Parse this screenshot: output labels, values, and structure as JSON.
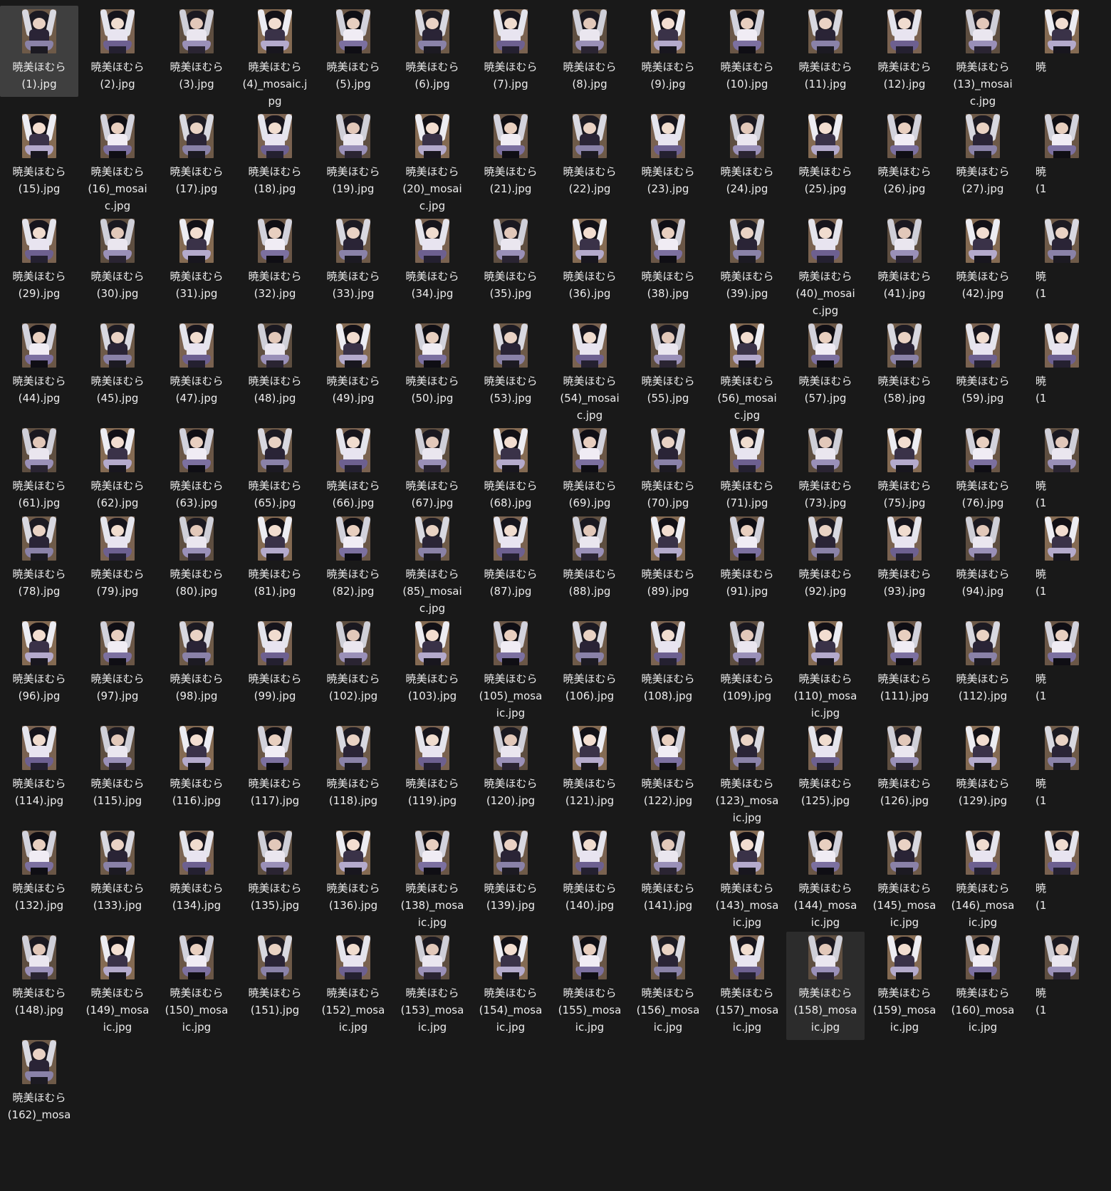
{
  "explorer": {
    "rows": [
      {
        "items": [
          {
            "name": "暁美ほむら\n(1).jpg"
          },
          {
            "name": "暁美ほむら\n(2).jpg"
          },
          {
            "name": "暁美ほむら\n(3).jpg"
          },
          {
            "name": "暁美ほむら\n(4)_mosaic.j\npg"
          },
          {
            "name": "暁美ほむら\n(5).jpg"
          },
          {
            "name": "暁美ほむら\n(6).jpg"
          },
          {
            "name": "暁美ほむら\n(7).jpg"
          },
          {
            "name": "暁美ほむら\n(8).jpg"
          },
          {
            "name": "暁美ほむら\n(9).jpg"
          },
          {
            "name": "暁美ほむら\n(10).jpg"
          },
          {
            "name": "暁美ほむら\n(11).jpg"
          },
          {
            "name": "暁美ほむら\n(12).jpg"
          },
          {
            "name": "暁美ほむら\n(13)_mosai\nc.jpg"
          }
        ]
      },
      {
        "items": [
          {
            "name": "暁美ほむら\n(15).jpg"
          },
          {
            "name": "暁美ほむら\n(16)_mosai\nc.jpg"
          },
          {
            "name": "暁美ほむら\n(17).jpg"
          },
          {
            "name": "暁美ほむら\n(18).jpg"
          },
          {
            "name": "暁美ほむら\n(19).jpg"
          },
          {
            "name": "暁美ほむら\n(20)_mosai\nc.jpg"
          },
          {
            "name": "暁美ほむら\n(21).jpg"
          },
          {
            "name": "暁美ほむら\n(22).jpg"
          },
          {
            "name": "暁美ほむら\n(23).jpg"
          },
          {
            "name": "暁美ほむら\n(24).jpg"
          },
          {
            "name": "暁美ほむら\n(25).jpg"
          },
          {
            "name": "暁美ほむら\n(26).jpg"
          },
          {
            "name": "暁美ほむら\n(27).jpg"
          }
        ]
      },
      {
        "items": [
          {
            "name": "暁美ほむら\n(29).jpg"
          },
          {
            "name": "暁美ほむら\n(30).jpg"
          },
          {
            "name": "暁美ほむら\n(31).jpg"
          },
          {
            "name": "暁美ほむら\n(32).jpg"
          },
          {
            "name": "暁美ほむら\n(33).jpg"
          },
          {
            "name": "暁美ほむら\n(34).jpg"
          },
          {
            "name": "暁美ほむら\n(35).jpg"
          },
          {
            "name": "暁美ほむら\n(36).jpg"
          },
          {
            "name": "暁美ほむら\n(38).jpg"
          },
          {
            "name": "暁美ほむら\n(39).jpg"
          },
          {
            "name": "暁美ほむら\n(40)_mosai\nc.jpg"
          },
          {
            "name": "暁美ほむら\n(41).jpg"
          },
          {
            "name": "暁美ほむら\n(42).jpg"
          }
        ]
      },
      {
        "items": [
          {
            "name": "暁美ほむら\n(44).jpg"
          },
          {
            "name": "暁美ほむら\n(45).jpg"
          },
          {
            "name": "暁美ほむら\n(47).jpg"
          },
          {
            "name": "暁美ほむら\n(48).jpg"
          },
          {
            "name": "暁美ほむら\n(49).jpg"
          },
          {
            "name": "暁美ほむら\n(50).jpg"
          },
          {
            "name": "暁美ほむら\n(53).jpg"
          },
          {
            "name": "暁美ほむら\n(54)_mosai\nc.jpg"
          },
          {
            "name": "暁美ほむら\n(55).jpg"
          },
          {
            "name": "暁美ほむら\n(56)_mosai\nc.jpg"
          },
          {
            "name": "暁美ほむら\n(57).jpg"
          },
          {
            "name": "暁美ほむら\n(58).jpg"
          },
          {
            "name": "暁美ほむら\n(59).jpg"
          }
        ]
      },
      {
        "items": [
          {
            "name": "暁美ほむら\n(61).jpg"
          },
          {
            "name": "暁美ほむら\n(62).jpg"
          },
          {
            "name": "暁美ほむら\n(63).jpg"
          },
          {
            "name": "暁美ほむら\n(65).jpg"
          },
          {
            "name": "暁美ほむら\n(66).jpg"
          },
          {
            "name": "暁美ほむら\n(67).jpg"
          },
          {
            "name": "暁美ほむら\n(68).jpg"
          },
          {
            "name": "暁美ほむら\n(69).jpg"
          },
          {
            "name": "暁美ほむら\n(70).jpg"
          },
          {
            "name": "暁美ほむら\n(71).jpg"
          },
          {
            "name": "暁美ほむら\n(73).jpg"
          },
          {
            "name": "暁美ほむら\n(75).jpg"
          },
          {
            "name": "暁美ほむら\n(76).jpg"
          }
        ]
      },
      {
        "items": [
          {
            "name": "暁美ほむら\n(78).jpg"
          },
          {
            "name": "暁美ほむら\n(79).jpg"
          },
          {
            "name": "暁美ほむら\n(80).jpg"
          },
          {
            "name": "暁美ほむら\n(81).jpg"
          },
          {
            "name": "暁美ほむら\n(82).jpg"
          },
          {
            "name": "暁美ほむら\n(85)_mosai\nc.jpg"
          },
          {
            "name": "暁美ほむら\n(87).jpg"
          },
          {
            "name": "暁美ほむら\n(88).jpg"
          },
          {
            "name": "暁美ほむら\n(89).jpg"
          },
          {
            "name": "暁美ほむら\n(91).jpg"
          },
          {
            "name": "暁美ほむら\n(92).jpg"
          },
          {
            "name": "暁美ほむら\n(93).jpg"
          },
          {
            "name": "暁美ほむら\n(94).jpg"
          }
        ]
      },
      {
        "items": [
          {
            "name": "暁美ほむら\n(96).jpg"
          },
          {
            "name": "暁美ほむら\n(97).jpg"
          },
          {
            "name": "暁美ほむら\n(98).jpg"
          },
          {
            "name": "暁美ほむら\n(99).jpg"
          },
          {
            "name": "暁美ほむら\n(102).jpg"
          },
          {
            "name": "暁美ほむら\n(103).jpg"
          },
          {
            "name": "暁美ほむら\n(105)_mosa\nic.jpg"
          },
          {
            "name": "暁美ほむら\n(106).jpg"
          },
          {
            "name": "暁美ほむら\n(108).jpg"
          },
          {
            "name": "暁美ほむら\n(109).jpg"
          },
          {
            "name": "暁美ほむら\n(110)_mosa\nic.jpg"
          },
          {
            "name": "暁美ほむら\n(111).jpg"
          },
          {
            "name": "暁美ほむら\n(112).jpg"
          }
        ]
      },
      {
        "items": [
          {
            "name": "暁美ほむら\n(114).jpg"
          },
          {
            "name": "暁美ほむら\n(115).jpg"
          },
          {
            "name": "暁美ほむら\n(116).jpg"
          },
          {
            "name": "暁美ほむら\n(117).jpg"
          },
          {
            "name": "暁美ほむら\n(118).jpg"
          },
          {
            "name": "暁美ほむら\n(119).jpg"
          },
          {
            "name": "暁美ほむら\n(120).jpg"
          },
          {
            "name": "暁美ほむら\n(121).jpg"
          },
          {
            "name": "暁美ほむら\n(122).jpg"
          },
          {
            "name": "暁美ほむら\n(123)_mosa\nic.jpg"
          },
          {
            "name": "暁美ほむら\n(125).jpg"
          },
          {
            "name": "暁美ほむら\n(126).jpg"
          },
          {
            "name": "暁美ほむら\n(129).jpg"
          }
        ]
      },
      {
        "items": [
          {
            "name": "暁美ほむら\n(132).jpg"
          },
          {
            "name": "暁美ほむら\n(133).jpg"
          },
          {
            "name": "暁美ほむら\n(134).jpg"
          },
          {
            "name": "暁美ほむら\n(135).jpg"
          },
          {
            "name": "暁美ほむら\n(136).jpg"
          },
          {
            "name": "暁美ほむら\n(138)_mosa\nic.jpg"
          },
          {
            "name": "暁美ほむら\n(139).jpg"
          },
          {
            "name": "暁美ほむら\n(140).jpg"
          },
          {
            "name": "暁美ほむら\n(141).jpg"
          },
          {
            "name": "暁美ほむら\n(143)_mosa\nic.jpg"
          },
          {
            "name": "暁美ほむら\n(144)_mosa\nic.jpg"
          },
          {
            "name": "暁美ほむら\n(145)_mosa\nic.jpg"
          },
          {
            "name": "暁美ほむら\n(146)_mosa\nic.jpg"
          }
        ]
      },
      {
        "items": [
          {
            "name": "暁美ほむら\n(148).jpg"
          },
          {
            "name": "暁美ほむら\n(149)_mosa\nic.jpg"
          },
          {
            "name": "暁美ほむら\n(150)_mosa\nic.jpg"
          },
          {
            "name": "暁美ほむら\n(151).jpg"
          },
          {
            "name": "暁美ほむら\n(152)_mosa\nic.jpg"
          },
          {
            "name": "暁美ほむら\n(153)_mosa\nic.jpg"
          },
          {
            "name": "暁美ほむら\n(154)_mosa\nic.jpg"
          },
          {
            "name": "暁美ほむら\n(155)_mosa\nic.jpg"
          },
          {
            "name": "暁美ほむら\n(156)_mosa\nic.jpg"
          },
          {
            "name": "暁美ほむら\n(157)_mosa\nic.jpg"
          },
          {
            "name": "暁美ほむら\n(158)_mosa\nic.jpg"
          },
          {
            "name": "暁美ほむら\n(159)_mosa\nic.jpg"
          },
          {
            "name": "暁美ほむら\n(160)_mosa\nic.jpg"
          }
        ]
      },
      {
        "items": [
          {
            "name": "暁美ほむら\n(162)_mosa"
          }
        ]
      }
    ],
    "partial_labels": [
      "暁",
      "暁\n(1",
      "暁\n(1",
      "暁\n(1",
      "暁\n(1",
      "暁\n(1",
      "暁\n(1",
      "暁\n(1",
      "暁\n(1",
      "暁\n(1"
    ],
    "selected": [
      "0-0",
      "9-10"
    ],
    "colors": {
      "background": "#191919",
      "label_text": "#ededed",
      "selected_primary": "#3f3f3f",
      "selected_secondary": "#2c2c2c"
    }
  }
}
